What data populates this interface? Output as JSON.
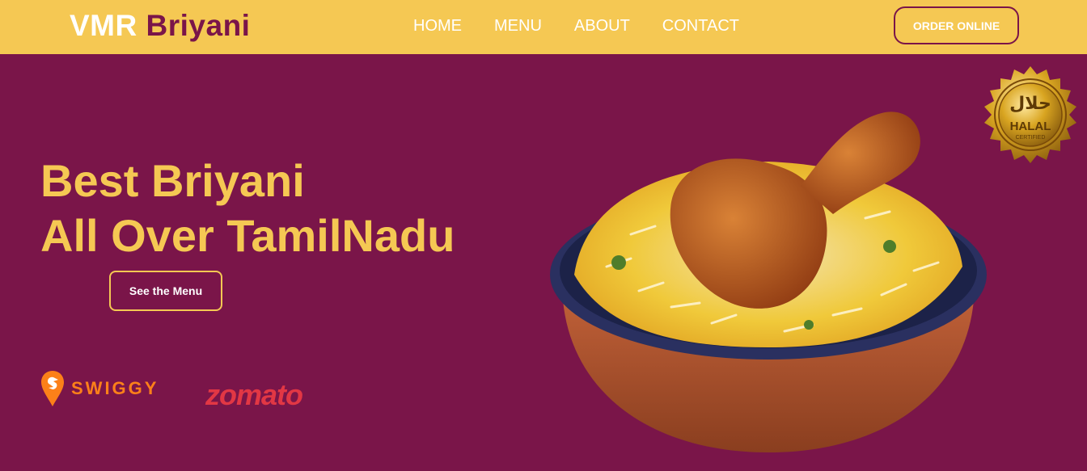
{
  "brand": {
    "part1": "VMR",
    "part2": "Briyani"
  },
  "nav": {
    "items": [
      "HOME",
      "MENU",
      "ABOUT",
      "CONTACT"
    ]
  },
  "header": {
    "order_label": "ORDER ONLINE"
  },
  "hero": {
    "line1": "Best Briyani",
    "line2": "All Over TamilNadu",
    "cta_label": "See the Menu"
  },
  "partners": {
    "swiggy": "SWIGGY",
    "zomato": "zomato"
  },
  "badge": {
    "arabic": "حلال",
    "title": "HALAL",
    "subtitle": "CERTIFIED"
  },
  "colors": {
    "primary": "#7a1549",
    "accent": "#f5c853",
    "swiggy": "#fc8019",
    "zomato": "#e23744"
  },
  "icons": {
    "swiggy": "swiggy-logo-icon",
    "seal": "halal-seal-icon",
    "dish": "biryani-dish-image"
  }
}
